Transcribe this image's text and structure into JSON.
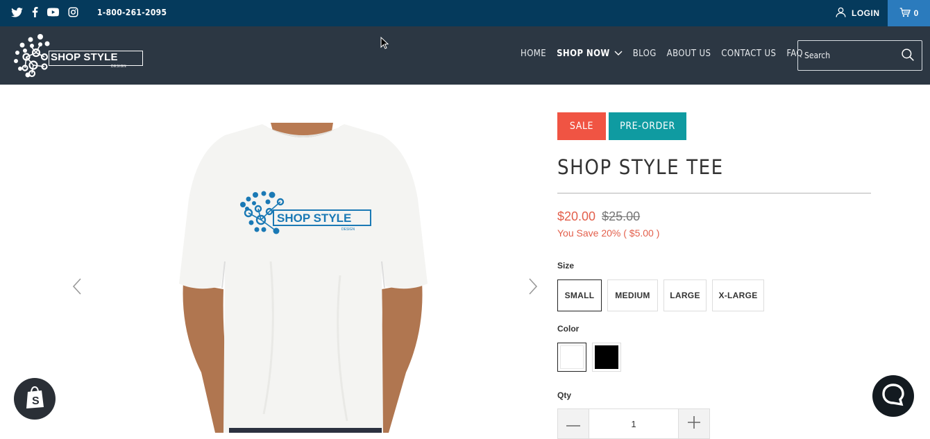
{
  "topbar": {
    "social_icons": [
      "twitter-icon",
      "facebook-icon",
      "youtube-icon",
      "instagram-icon"
    ],
    "phone": "1-800-261-2095",
    "login_label": "LOGIN",
    "cart_count": "0"
  },
  "header": {
    "logo_text": "SHOP STYLE",
    "logo_subtext": "DESIGN",
    "nav": [
      {
        "label": "HOME"
      },
      {
        "label": "SHOP NOW"
      },
      {
        "label": "BLOG"
      },
      {
        "label": "ABOUT US"
      },
      {
        "label": "CONTACT US"
      },
      {
        "label": "FAQ"
      }
    ],
    "search_placeholder": "Search"
  },
  "product": {
    "badges": {
      "sale": "SALE",
      "preorder": "PRE-ORDER"
    },
    "title": "SHOP STYLE TEE",
    "price": "$20.00",
    "compare_price": "$25.00",
    "savings": "You Save 20% ( $5.00 )",
    "size_label": "Size",
    "sizes": [
      "SMALL",
      "MEDIUM",
      "LARGE",
      "X-LARGE"
    ],
    "selected_size": "SMALL",
    "color_label": "Color",
    "colors": [
      {
        "name": "White",
        "hex": "#ffffff"
      },
      {
        "name": "Black",
        "hex": "#000000"
      }
    ],
    "qty_label": "Qty",
    "qty_value": "1",
    "shirt_logo_text": "SHOP STYLE",
    "shirt_logo_subtext": "DESIGN"
  },
  "colors": {
    "topbar": "#053a5c",
    "header": "#2c3743",
    "cart": "#2b7bbd",
    "sale": "#f05443",
    "preorder": "#0f9ba1",
    "price": "#e35f4b"
  }
}
